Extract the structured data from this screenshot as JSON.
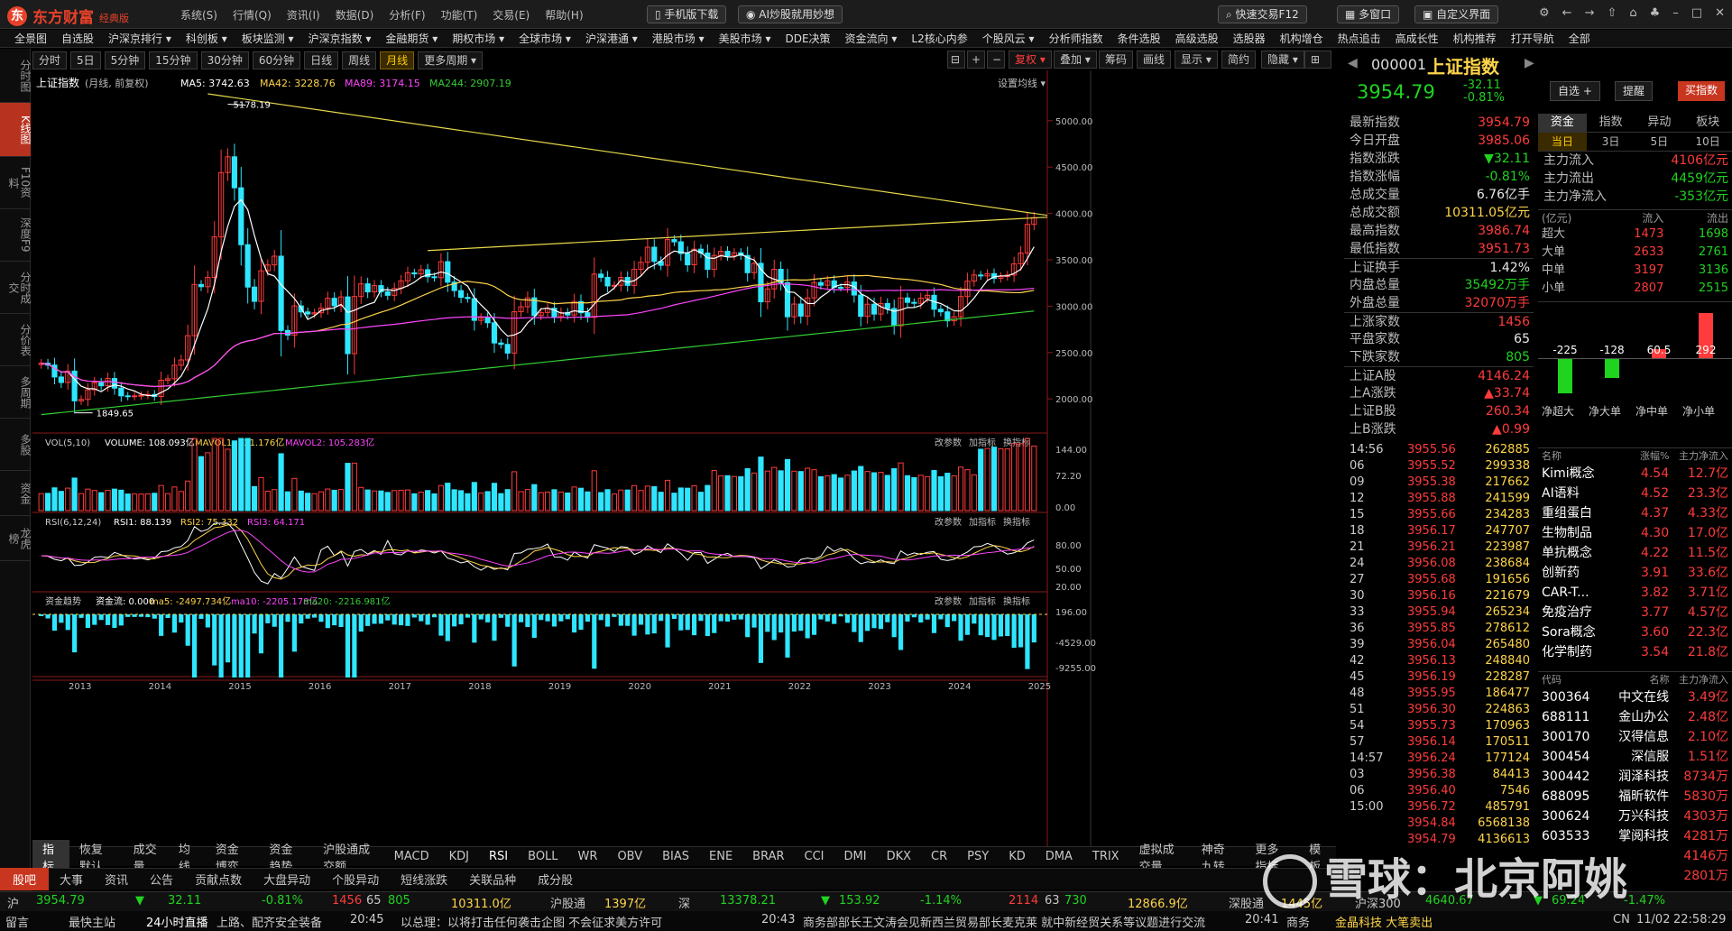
{
  "app": {
    "brand": "东方财富",
    "edition": "经典版",
    "menus": [
      "系统(S)",
      "行情(Q)",
      "资讯(I)",
      "数据(D)",
      "分析(F)",
      "功能(T)",
      "交易(E)",
      "帮助(H)"
    ],
    "mobile_download": "手机版下载",
    "ai_promo": "AI炒股就用妙想",
    "quick_trade": "快速交易F12",
    "multi_window": "多窗口",
    "custom_layout": "自定义界面"
  },
  "nav": [
    "全景图",
    "自选股",
    "沪深京排行 ▾",
    "科创板 ▾",
    "板块监测 ▾",
    "沪深京指数 ▾",
    "金融期货 ▾",
    "期权市场 ▾",
    "全球市场 ▾",
    "沪深港通 ▾",
    "港股市场 ▾",
    "美股市场 ▾",
    "DDE决策",
    "资金流向 ▾",
    "L2核心内参",
    "个股风云 ▾",
    "分析师指数",
    "条件选股",
    "高级选股",
    "选股器",
    "机构增仓",
    "热点追击",
    "高成长性",
    "机构推荐",
    "打开导航",
    "全部"
  ],
  "leftbar": [
    "分时图",
    "K线图",
    "F10资料",
    "深度F9",
    "分时成交",
    "分价表",
    "多周期",
    "多股",
    "资金",
    "龙虎榜"
  ],
  "periods": [
    "分时",
    "5日",
    "5分钟",
    "15分钟",
    "30分钟",
    "60分钟",
    "日线",
    "周线",
    "月线",
    "更多周期 ▾"
  ],
  "toolbar": {
    "fuquan": "复权 ▾",
    "overlay": "叠加 ▾",
    "chip": "筹码",
    "draw": "画线",
    "display": "显示 ▾",
    "simple": "简约",
    "hide": "隐藏 ▾"
  },
  "main_legend": {
    "name": "上证指数",
    "mode": "(月线, 前复权)",
    "ma_label": "MA",
    "ma5": "MA5: 3742.63",
    "ma42": "MA42: 3228.76",
    "ma89": "MA89: 3174.15",
    "ma244": "MA244: 2907.19",
    "settings": "设置均线 ▾"
  },
  "vol_legend": {
    "name": "VOL(5,10)",
    "volume": "VOLUME: 108.093亿",
    "mavol1": "MAVOL1: 121.176亿",
    "mavol2": "MAVOL2: 105.283亿"
  },
  "rsi_legend": {
    "name": "RSI(6,12,24)",
    "rsi1": "RSI1: 88.139",
    "rsi2": "RSI2: 75.332",
    "rsi3": "RSI3: 64.171"
  },
  "fund_legend": {
    "name": "资金趋势",
    "flow": "资金流: 0.000",
    "ma5": "ma5: -2497.734亿",
    "ma10": "ma10: -2205.178亿",
    "ma20": "ma20: -2216.981亿"
  },
  "pane_tools": [
    "改参数",
    "加指标",
    "换指标"
  ],
  "annotations": {
    "high": "5178.19",
    "low": "1849.65"
  },
  "chart_data": {
    "type": "candlestick",
    "title": "上证指数",
    "period": "月线",
    "price_axis": {
      "ticks": [
        "5000.00",
        "4500.00",
        "4000.00",
        "3500.00",
        "3000.00",
        "2500.00",
        "2000.00"
      ],
      "range": [
        1700,
        5300
      ]
    },
    "vol_axis": {
      "ticks": [
        "144.00",
        "72.20",
        "0.00"
      ]
    },
    "rsi_axis": {
      "ticks": [
        "80.00",
        "50.00",
        "20.00"
      ]
    },
    "fund_axis": {
      "ticks": [
        "196.00",
        "-4529.00",
        "-9255.00"
      ]
    },
    "x_labels": [
      "2013",
      "2014",
      "2015",
      "2016",
      "2017",
      "2018",
      "2019",
      "2020",
      "2021",
      "2022",
      "2023",
      "2024",
      "2025"
    ],
    "closes": [
      2385,
      2365,
      2236,
      2177,
      2300,
      1979,
      1994,
      2098,
      2175,
      2141,
      2220,
      2116,
      2033,
      2026,
      2033,
      2039,
      2048,
      2026,
      2201,
      2217,
      2363,
      2420,
      2682,
      3234,
      3210,
      3310,
      3747,
      4441,
      4611,
      4277,
      3663,
      3206,
      3052,
      3382,
      3445,
      3539,
      2738,
      2688,
      3003,
      2938,
      2916,
      2929,
      2979,
      3085,
      3004,
      3100,
      2488,
      3104,
      3241,
      3154,
      3222,
      3155,
      3117,
      3192,
      3273,
      3360,
      3348,
      3393,
      3317,
      3307,
      3480,
      3259,
      3168,
      3095,
      3082,
      2847,
      2876,
      2821,
      2603,
      2588,
      2494,
      2940,
      2994,
      3090,
      2898,
      2932,
      2978,
      2886,
      2932,
      2905,
      3050,
      2929,
      2880,
      3346,
      3311,
      3218,
      3225,
      3310,
      3224,
      3397,
      3473,
      3636,
      3483,
      3441,
      3718,
      3694,
      3568,
      3446,
      3615,
      3573,
      3397,
      3547,
      3592,
      3544,
      3576,
      3547,
      3361,
      3462,
      3047,
      3186,
      3398,
      3253,
      2886,
      3023,
      2893,
      3089,
      3255,
      3226,
      3273,
      3204,
      3202,
      3261,
      3120,
      2890,
      3021,
      2915,
      3029,
      2975,
      2789,
      3089,
      3041,
      3031,
      3087,
      3117,
      2967,
      2939,
      2842,
      2886,
      3104,
      3270,
      3336,
      3326,
      3351,
      3300,
      3320,
      3336,
      3457,
      3573,
      3882,
      3955
    ],
    "up_flags_note": "colors derived from close vs previous close"
  },
  "quote": {
    "code": "000001",
    "name": "上证指数",
    "price": "3954.79",
    "change": "-32.11",
    "pct": "-0.81%",
    "self_select": "自选 +",
    "alert": "提醒",
    "buy": "买指数",
    "stats": [
      [
        "最新指数",
        "3954.79",
        "red"
      ],
      [
        "今日开盘",
        "3985.06",
        "red"
      ],
      [
        "指数涨跌",
        "▼32.11",
        "green"
      ],
      [
        "指数涨幅",
        "-0.81%",
        "green"
      ],
      [
        "总成交量",
        "6.76亿手",
        "wht"
      ],
      [
        "总成交额",
        "10311.05亿元",
        "yel"
      ],
      [
        "最高指数",
        "3986.74",
        "red"
      ],
      [
        "最低指数",
        "3951.73",
        "red"
      ],
      [
        "上证换手",
        "1.42%",
        "wht"
      ],
      [
        "内盘总量",
        "35492万手",
        "green"
      ],
      [
        "外盘总量",
        "32070万手",
        "red"
      ],
      [
        "上涨家数",
        "1456",
        "red"
      ],
      [
        "平盘家数",
        "65",
        "wht"
      ],
      [
        "下跌家数",
        "805",
        "green"
      ],
      [
        "上证A股",
        "4146.24",
        "red"
      ],
      [
        "上A涨跌",
        "▲33.74",
        "red"
      ],
      [
        "上证B股",
        "260.34",
        "red"
      ],
      [
        "上B涨跌",
        "▲0.99",
        "red"
      ]
    ],
    "ticks": [
      [
        "14:56",
        "3955.56",
        "262885"
      ],
      [
        "06",
        "3955.52",
        "299338"
      ],
      [
        "09",
        "3955.38",
        "217662"
      ],
      [
        "12",
        "3955.88",
        "241599"
      ],
      [
        "15",
        "3955.66",
        "234283"
      ],
      [
        "18",
        "3956.17",
        "247707"
      ],
      [
        "21",
        "3956.21",
        "223987"
      ],
      [
        "24",
        "3956.08",
        "238684"
      ],
      [
        "27",
        "3955.68",
        "191656"
      ],
      [
        "30",
        "3956.16",
        "221679"
      ],
      [
        "33",
        "3955.94",
        "265234"
      ],
      [
        "36",
        "3955.85",
        "278612"
      ],
      [
        "39",
        "3956.04",
        "265480"
      ],
      [
        "42",
        "3956.13",
        "248840"
      ],
      [
        "45",
        "3956.19",
        "228287"
      ],
      [
        "48",
        "3955.95",
        "186477"
      ],
      [
        "51",
        "3956.30",
        "224863"
      ],
      [
        "54",
        "3955.73",
        "170963"
      ],
      [
        "57",
        "3956.14",
        "170511"
      ],
      [
        "14:57",
        "3956.24",
        "177124"
      ],
      [
        "03",
        "3956.38",
        "84413"
      ],
      [
        "06",
        "3956.40",
        "7546"
      ],
      [
        "15:00",
        "3956.72",
        "485791"
      ],
      [
        "",
        "3954.84",
        "6568138"
      ],
      [
        "",
        "3954.79",
        "4136613"
      ]
    ]
  },
  "fund": {
    "tabs": [
      "资金",
      "指数",
      "异动",
      "板块"
    ],
    "periods": [
      "当日",
      "3日",
      "5日",
      "10日"
    ],
    "flows": [
      [
        "主力流入",
        "4106亿元",
        "red"
      ],
      [
        "主力流出",
        "4459亿元",
        "green"
      ],
      [
        "主力净流入",
        "-353亿元",
        "green"
      ]
    ],
    "table_head": [
      "(亿元)",
      "流入",
      "流出"
    ],
    "rows": [
      [
        "超大",
        "1473",
        "1698"
      ],
      [
        "大单",
        "2633",
        "2761"
      ],
      [
        "中单",
        "3197",
        "3136"
      ],
      [
        "小单",
        "2807",
        "2515"
      ]
    ],
    "net_values": [
      "-225",
      "-128",
      "60.5",
      "292"
    ],
    "net_labels": [
      "净超大",
      "净大单",
      "净中单",
      "净小单"
    ]
  },
  "sectors": {
    "head": [
      "名称",
      "涨幅%",
      "主力净流入"
    ],
    "rows": [
      [
        "Kimi概念",
        "4.54",
        "12.7亿"
      ],
      [
        "AI语料",
        "4.52",
        "23.3亿"
      ],
      [
        "重组蛋白",
        "4.37",
        "4.33亿"
      ],
      [
        "生物制品",
        "4.30",
        "17.0亿"
      ],
      [
        "单抗概念",
        "4.22",
        "11.5亿"
      ],
      [
        "创新药",
        "3.91",
        "33.6亿"
      ],
      [
        "CAR-T...",
        "3.82",
        "3.71亿"
      ],
      [
        "免疫治疗",
        "3.77",
        "4.57亿"
      ],
      [
        "Sora概念",
        "3.60",
        "22.3亿"
      ],
      [
        "化学制药",
        "3.54",
        "21.8亿"
      ]
    ]
  },
  "stocks": {
    "head": [
      "代码",
      "名称",
      "主力净流入"
    ],
    "rows": [
      [
        "300364",
        "中文在线",
        "3.49亿"
      ],
      [
        "688111",
        "金山办公",
        "2.48亿"
      ],
      [
        "300170",
        "汉得信息",
        "2.10亿"
      ],
      [
        "300454",
        "深信服",
        "1.51亿"
      ],
      [
        "300442",
        "润泽科技",
        "8734万"
      ],
      [
        "688095",
        "福昕软件",
        "5830万"
      ],
      [
        "300624",
        "万兴科技",
        "4303万"
      ],
      [
        "603533",
        "掌阅科技",
        "4281万"
      ],
      [
        "",
        "",
        "4146万"
      ],
      [
        "",
        "",
        "2801万"
      ]
    ]
  },
  "indicators": [
    "指标",
    "恢复默认",
    "成交量",
    "均线",
    "资金博弈",
    "资金趋势",
    "沪股通成交额",
    "MACD",
    "KDJ",
    "RSI",
    "BOLL",
    "WR",
    "OBV",
    "BIAS",
    "ENE",
    "BRAR",
    "CCI",
    "DMI",
    "DKX",
    "CR",
    "PSY",
    "KD",
    "DMA",
    "TRIX",
    "虚拟成交量",
    "神奇九转",
    "更多指标",
    "模板"
  ],
  "bottom_tabs": [
    "股吧",
    "大事",
    "资讯",
    "公告",
    "贡献点数",
    "大盘异动",
    "个股异动",
    "短线涨跌",
    "关联品种",
    "成分股"
  ],
  "status": {
    "sh": "沪",
    "sh_price": "3954.79",
    "sh_chg": "32.11",
    "sh_pct": "-0.81%",
    "sh_up": "1456",
    "sh_flat": "65",
    "sh_down": "805",
    "sh_amt": "10311.0亿",
    "hgt": "沪股通",
    "hgt_v": "1397亿",
    "sz": "深",
    "sz_price": "13378.21",
    "sz_chg": "153.92",
    "sz_pct": "-1.14%",
    "sz_up": "2114",
    "sz_flat": "63",
    "sz_down": "730",
    "sz_amt": "12866.9亿",
    "sgt": "深股通",
    "sgt_v": "1445亿",
    "hs300": "沪深300",
    "hs300_v": "4640.67",
    "hs300_c": "69.24",
    "hs300_p": "-1.47%"
  },
  "news": {
    "items": [
      "留言",
      "最快主站",
      "24小时直播",
      "上路、配齐安全装备",
      "20:45",
      "以总理：以将打击任何袭击企图 不会征求美方许可",
      "20:43",
      "商务部部长王文涛会见新西兰贸易部长麦克莱 就中新经贸关系等议题进行交流",
      "20:41",
      "商务"
    ],
    "right": "金晶科技 大笔卖出",
    "clock": "22:58:29",
    "date": "11/02",
    "lang": "CN"
  },
  "watermark": "雪球：北京阿姚"
}
